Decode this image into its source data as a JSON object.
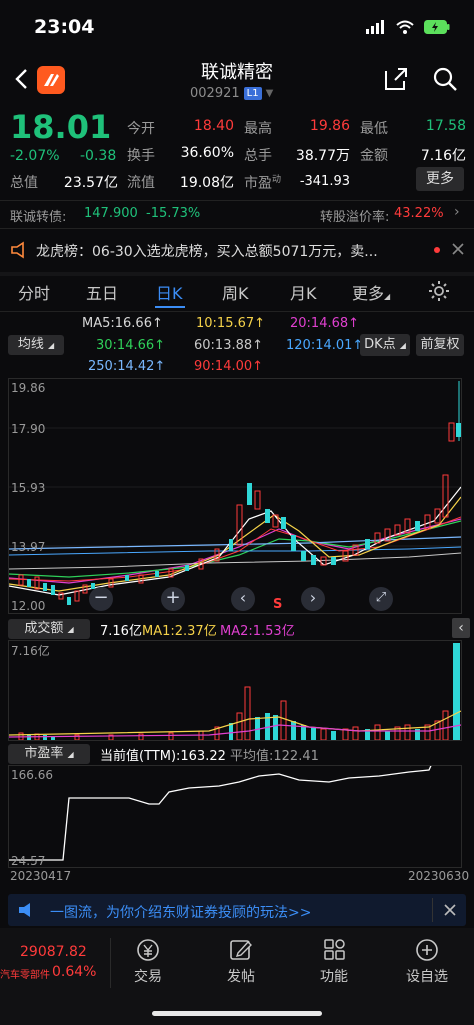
{
  "status": {
    "time": "23:04"
  },
  "header": {
    "title": "联诚精密",
    "code": "002921",
    "badge": "L1"
  },
  "quote": {
    "price": "18.01",
    "change_pct": "-2.07%",
    "change_abs": "-0.38",
    "fields": [
      {
        "label": "今开",
        "value": "18.40",
        "color": "red"
      },
      {
        "label": "最高",
        "value": "19.86",
        "color": "red"
      },
      {
        "label": "最低",
        "value": "17.58",
        "color": "green"
      },
      {
        "label": "换手",
        "value": "36.60%",
        "color": "white"
      },
      {
        "label": "总手",
        "value": "38.77万",
        "color": "white"
      },
      {
        "label": "金额",
        "value": "7.16亿",
        "color": "white"
      },
      {
        "label": "总值",
        "value": "23.57亿",
        "color": "white"
      },
      {
        "label": "流值",
        "value": "19.08亿",
        "color": "white"
      },
      {
        "label": "市盈",
        "label_sup": "动",
        "value": "-341.93",
        "color": "white"
      }
    ],
    "more_label": "更多"
  },
  "convertible": {
    "label": "联诚转债:",
    "price": "147.900",
    "pct": "-15.73%",
    "premium_label": "转股溢价率:",
    "premium": "43.22%"
  },
  "notice": {
    "text": "龙虎榜：06-30入选龙虎榜，买入总额5071万元，卖..."
  },
  "tabs": [
    {
      "label": "分时"
    },
    {
      "label": "五日"
    },
    {
      "label": "日K"
    },
    {
      "label": "周K"
    },
    {
      "label": "月K"
    },
    {
      "label": "更多"
    }
  ],
  "ma_legend": {
    "selector": "均线",
    "dk_label": "DK点",
    "fq_label": "前复权",
    "items": [
      {
        "text": "MA5:16.66",
        "color": "#ffffff"
      },
      {
        "text": "10:15.67",
        "color": "#f5d24a"
      },
      {
        "text": "20:14.68",
        "color": "#e040d0"
      },
      {
        "text": "30:14.66",
        "color": "#2fd15a"
      },
      {
        "text": "60:13.88",
        "color": "#c8c8c8"
      },
      {
        "text": "120:14.01",
        "color": "#4aa8ff"
      },
      {
        "text": "250:14.42",
        "color": "#7ab8ff"
      },
      {
        "text": "90:14.00",
        "color": "#ff3b3b"
      }
    ]
  },
  "kline": {
    "y_labels": [
      "19.86",
      "17.90",
      "15.93",
      "13.97",
      "12.00"
    ],
    "marker": "S"
  },
  "volume": {
    "selector": "成交额",
    "value": "7.16亿",
    "ma1": "MA1:2.37亿",
    "ma2": "MA2:1.53亿",
    "top_label": "7.16亿"
  },
  "pe": {
    "selector": "市盈率",
    "current": "当前值(TTM):163.22",
    "avg": "平均值:122.41",
    "top_label": "166.66",
    "bottom_label": "24.57",
    "start_date": "20230417",
    "end_date": "20230630"
  },
  "promo": {
    "text": "一图流，为你介绍东财证券投顾的玩法>>"
  },
  "bottom": {
    "index_value": "29087.82",
    "index_name": "汽车零部件",
    "index_pct": "0.64%",
    "nav": [
      {
        "label": "交易",
        "icon": "yuan-icon"
      },
      {
        "label": "发帖",
        "icon": "edit-icon"
      },
      {
        "label": "功能",
        "icon": "grid-icon"
      },
      {
        "label": "设自选",
        "icon": "plus-circle-icon"
      }
    ]
  },
  "colors": {
    "up": "#ff3b3b",
    "down": "#1fc17a",
    "accent": "#3b8df5",
    "up_candle": "#ff3b3b",
    "down_candle": "#2fd7d7"
  }
}
